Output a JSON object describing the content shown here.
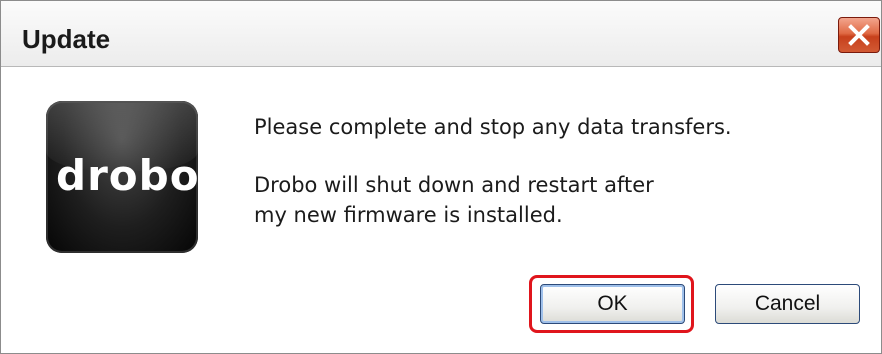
{
  "dialog": {
    "title": "Update",
    "logo_text": "drobo",
    "message_line1": "Please complete and stop any data transfers.",
    "message_line2": "Drobo will shut down and restart after",
    "message_line3": "my new firmware is installed."
  },
  "buttons": {
    "ok_label": "OK",
    "cancel_label": "Cancel"
  },
  "icons": {
    "close": "close-icon",
    "logo": "drobo-logo"
  },
  "colors": {
    "highlight": "#e0151c",
    "close_button": "#d25a34"
  }
}
